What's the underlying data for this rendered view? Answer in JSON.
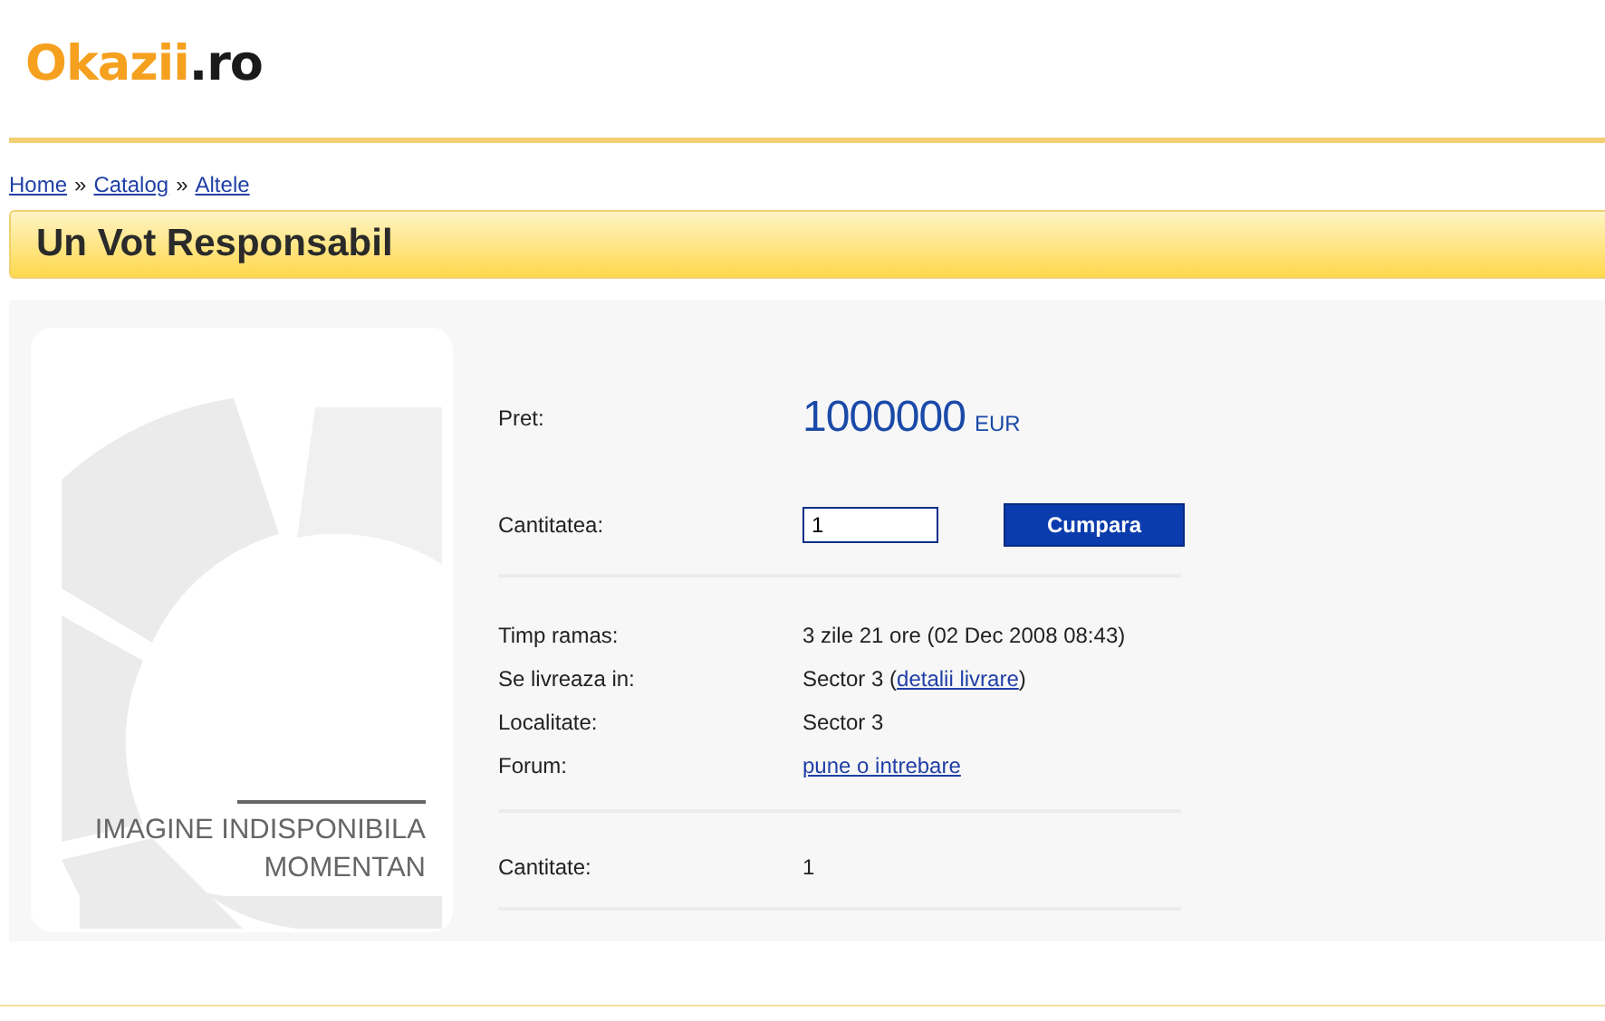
{
  "logo": {
    "brand": "Okazii",
    "suffix": ".ro"
  },
  "breadcrumb": [
    {
      "label": "Home"
    },
    {
      "label": "Catalog"
    },
    {
      "label": "Altele"
    }
  ],
  "breadcrumb_separator": "»",
  "title": "Un Vot Responsabil",
  "image": {
    "kind": "placeholder",
    "caption_lines": [
      "IMAGINE INDISPONIBILA",
      "MOMENTAN"
    ]
  },
  "sections": [
    {
      "rows": [
        {
          "kind": "price",
          "label": "Pret:",
          "amount": "1000000",
          "currency": "EUR"
        },
        {
          "kind": "quantity",
          "label": "Cantitatea:",
          "value": "1",
          "button": "Cumpara"
        }
      ]
    },
    {
      "rows": [
        {
          "kind": "text",
          "label": "Timp ramas:",
          "value": "3 zile 21 ore (02 Dec 2008 08:43)"
        },
        {
          "kind": "text_link",
          "label": "Se livreaza in:",
          "before": "Sector 3 (",
          "link": "detalii livrare",
          "after": ")"
        },
        {
          "kind": "text",
          "label": "Localitate:",
          "value": "Sector 3"
        },
        {
          "kind": "link",
          "label": "Forum:",
          "link": "pune o intrebare"
        }
      ]
    },
    {
      "rows": [
        {
          "kind": "text",
          "label": "Cantitate:",
          "value": "1"
        }
      ]
    }
  ]
}
